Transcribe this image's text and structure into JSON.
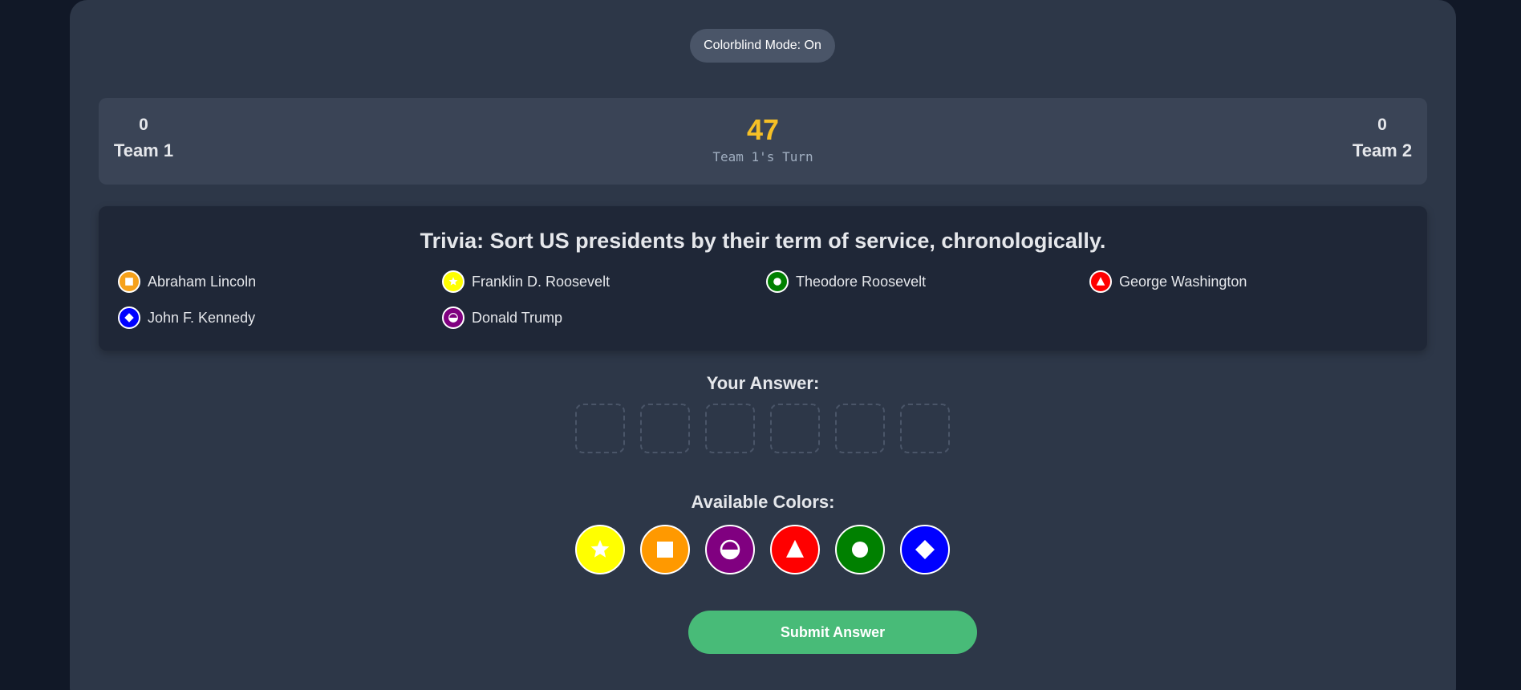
{
  "colorblind_toggle": "Colorblind Mode: On",
  "scoreboard": {
    "team1": {
      "score": "0",
      "name": "Team 1"
    },
    "team2": {
      "score": "0",
      "name": "Team 2"
    },
    "timer": "47",
    "turn": "Team 1's Turn"
  },
  "question": "Trivia: Sort US presidents by their term of service, chronologically.",
  "options": [
    {
      "label": "Abraham Lincoln",
      "color": "#f6a11a",
      "symbol": "square"
    },
    {
      "label": "Franklin D. Roosevelt",
      "color": "#ffff00",
      "symbol": "star"
    },
    {
      "label": "Theodore Roosevelt",
      "color": "#008000",
      "symbol": "circle"
    },
    {
      "label": "George Washington",
      "color": "#ff0000",
      "symbol": "triangle"
    },
    {
      "label": "John F. Kennedy",
      "color": "#0000ff",
      "symbol": "diamond"
    },
    {
      "label": "Donald Trump",
      "color": "#800080",
      "symbol": "half-circle"
    }
  ],
  "answer_label": "Your Answer:",
  "answer_slots": 6,
  "colors_label": "Available Colors:",
  "available_colors": [
    {
      "color": "#ffff00",
      "symbol": "star"
    },
    {
      "color": "#ff9900",
      "symbol": "square"
    },
    {
      "color": "#800080",
      "symbol": "half-circle"
    },
    {
      "color": "#ff0000",
      "symbol": "triangle"
    },
    {
      "color": "#008000",
      "symbol": "circle"
    },
    {
      "color": "#0000ff",
      "symbol": "diamond"
    }
  ],
  "submit_label": "Submit Answer"
}
